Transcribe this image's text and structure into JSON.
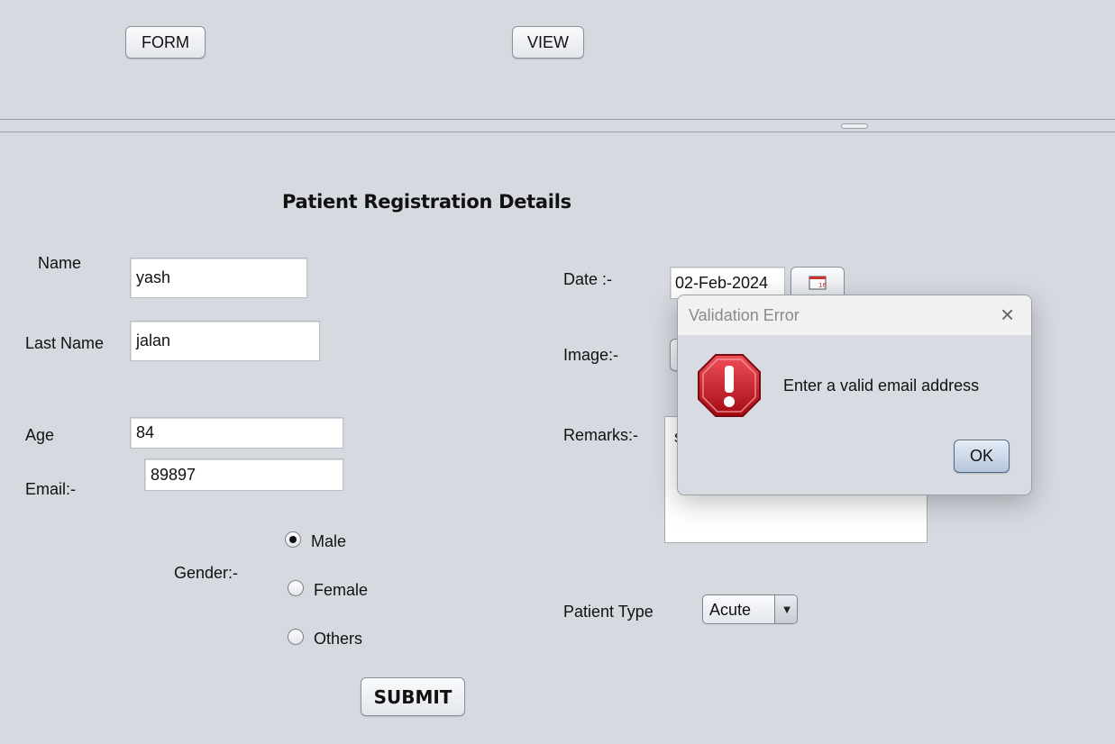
{
  "top_nav": {
    "form_label": "FORM",
    "view_label": "VIEW"
  },
  "form": {
    "heading": "Patient Registration Details",
    "name_label": "Name",
    "name_value": "yash",
    "last_name_label": "Last Name",
    "last_name_value": "jalan",
    "age_label": "Age",
    "age_value": "84",
    "email_label": "Email:-",
    "email_value": "89897",
    "gender_label": "Gender:-",
    "gender_options": [
      "Male",
      "Female",
      "Others"
    ],
    "gender_selected": "Male",
    "date_label": "Date :-",
    "date_value": "02-Feb-2024",
    "image_label": "Image:-",
    "remarks_label": "Remarks:-",
    "remarks_value": "s",
    "patient_type_label": "Patient Type",
    "patient_type_value": "Acute",
    "submit_label": "SUBMIT"
  },
  "dialog": {
    "title": "Validation Error",
    "message": "Enter a valid email address",
    "ok_label": "OK",
    "icon": "error-icon",
    "icon_color": "#c8141e"
  },
  "colors": {
    "background": "#d6d9e0",
    "field_background": "#ffffff"
  }
}
